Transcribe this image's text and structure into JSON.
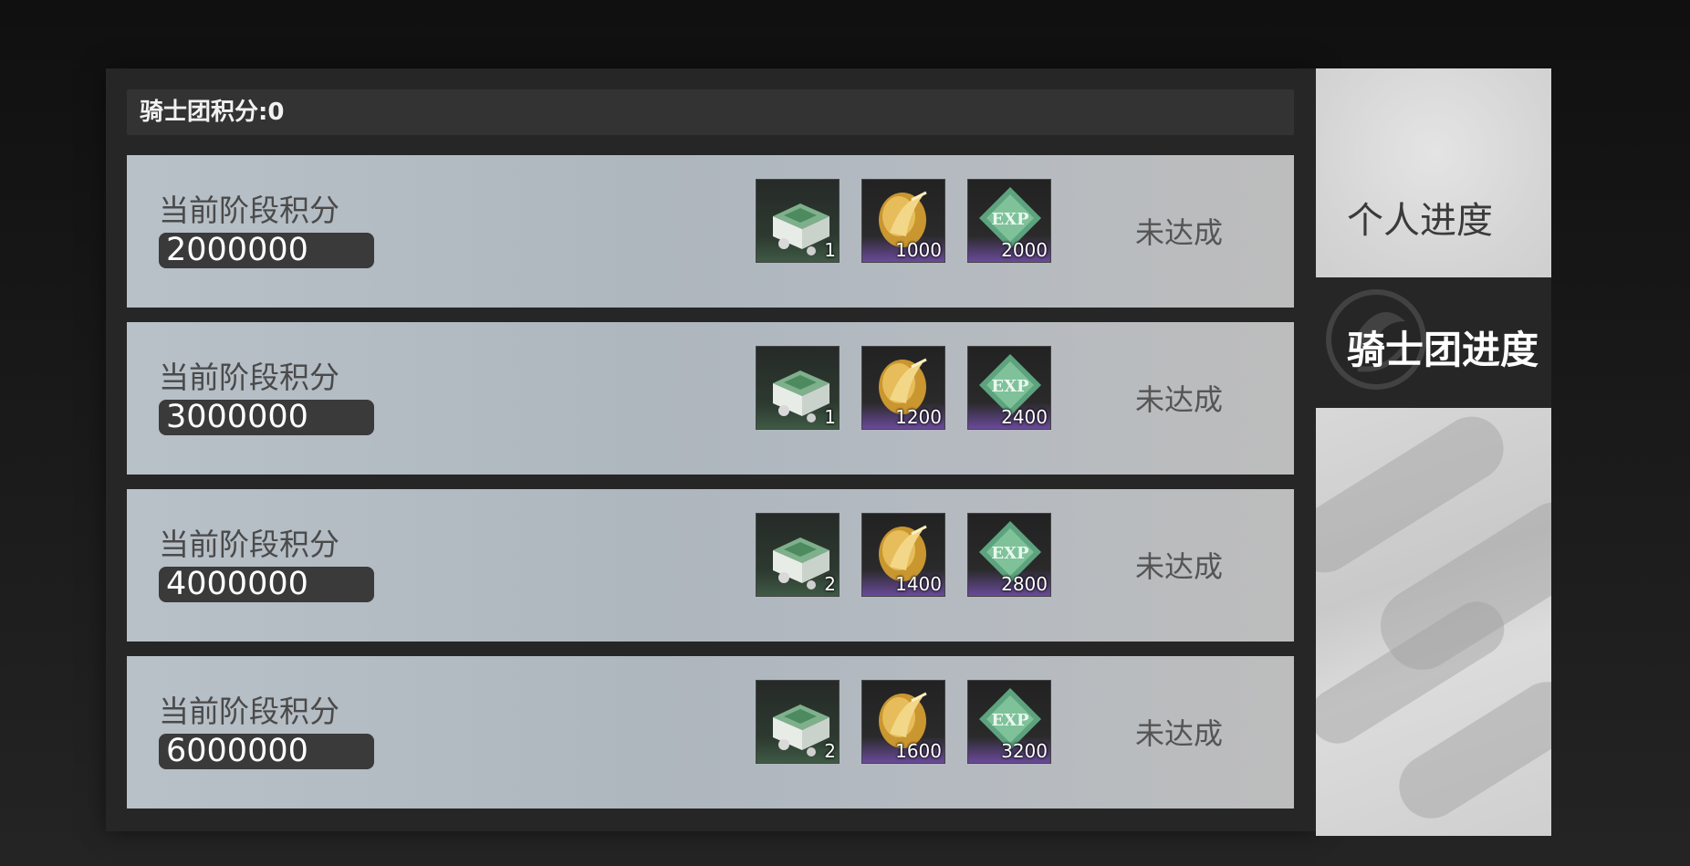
{
  "header": {
    "score_label": "骑士团积分",
    "score_separator": ":",
    "score_value": "0"
  },
  "rows": [
    {
      "label": "当前阶段积分",
      "points": "2000000",
      "status": "未达成",
      "rewards": [
        {
          "icon": "supply-crate-icon",
          "count": "1"
        },
        {
          "icon": "gold-feather-coin-icon",
          "count": "1000"
        },
        {
          "icon": "exp-crystal-icon",
          "count": "2000"
        }
      ]
    },
    {
      "label": "当前阶段积分",
      "points": "3000000",
      "status": "未达成",
      "rewards": [
        {
          "icon": "supply-crate-icon",
          "count": "1"
        },
        {
          "icon": "gold-feather-coin-icon",
          "count": "1200"
        },
        {
          "icon": "exp-crystal-icon",
          "count": "2400"
        }
      ]
    },
    {
      "label": "当前阶段积分",
      "points": "4000000",
      "status": "未达成",
      "rewards": [
        {
          "icon": "supply-crate-icon",
          "count": "2"
        },
        {
          "icon": "gold-feather-coin-icon",
          "count": "1400"
        },
        {
          "icon": "exp-crystal-icon",
          "count": "2800"
        }
      ]
    },
    {
      "label": "当前阶段积分",
      "points": "6000000",
      "status": "未达成",
      "rewards": [
        {
          "icon": "supply-crate-icon",
          "count": "2"
        },
        {
          "icon": "gold-feather-coin-icon",
          "count": "1600"
        },
        {
          "icon": "exp-crystal-icon",
          "count": "3200"
        }
      ]
    }
  ],
  "tabs": {
    "personal": "个人进度",
    "knights": "骑士团进度",
    "active": "knights"
  },
  "exp_icon_text": "EXP",
  "colors": {
    "panel": "#262626",
    "row_bg": "#b4bac0",
    "value_pill": "#3a3a3a",
    "reward_rarity_purple": "#6a4a9a",
    "reward_rarity_green": "#3f5a45"
  }
}
